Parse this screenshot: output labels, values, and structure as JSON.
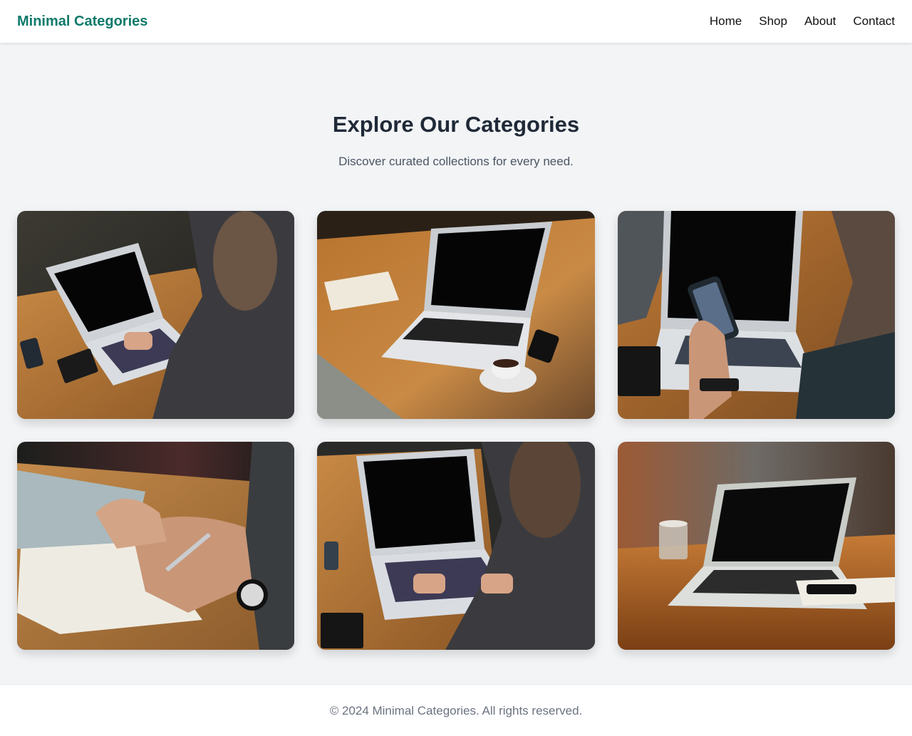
{
  "header": {
    "brand": "Minimal Categories",
    "nav": [
      "Home",
      "Shop",
      "About",
      "Contact"
    ]
  },
  "hero": {
    "title": "Explore Our Categories",
    "subtitle": "Discover curated collections for every need."
  },
  "categories": [
    {
      "photo": "person typing on laptop at wooden table"
    },
    {
      "photo": "laptop with notebook and coffee cup on wooden table"
    },
    {
      "photo": "person holding phone in front of laptop"
    },
    {
      "photo": "person writing in notebook beside laptop"
    },
    {
      "photo": "person typing on laptop at wooden table"
    },
    {
      "photo": "laptop with glass of water on wooden table"
    }
  ],
  "footer": {
    "text": "© 2024 Minimal Categories. All rights reserved."
  },
  "colors": {
    "brand": "#0f7a6a",
    "background": "#f2f4f6",
    "heading": "#1f2937",
    "muted": "#4b5563"
  }
}
